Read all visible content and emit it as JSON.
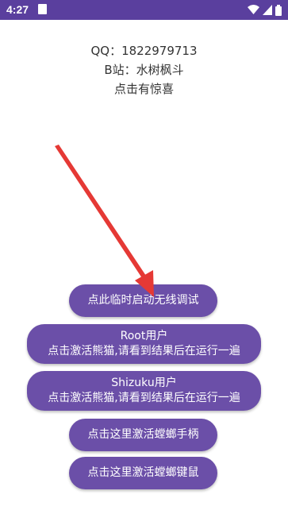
{
  "status_bar": {
    "time": "4:27",
    "bg_color": "#5a3f9e",
    "icons": [
      "notification-square-icon",
      "wifi-icon",
      "signal-icon",
      "battery-icon"
    ]
  },
  "info": {
    "qq": "QQ：1822979713",
    "bilibili": "B站：水树枫斗",
    "hint": "点击有惊喜"
  },
  "buttons": {
    "wireless_debug": "点此临时启动无线调试",
    "root_title": "Root用户",
    "root_desc": "点击激活熊猫,请看到结果后在运行一遍",
    "shizuku_title": "Shizuku用户",
    "shizuku_desc": "点击激活熊猫,请看到结果后在运行一遍",
    "gamepad": "点击这里激活螳螂手柄",
    "keyboard_mouse": "点击这里激活螳螂键鼠"
  },
  "colors": {
    "button": "#6b4fa8",
    "arrow": "#e53935"
  }
}
